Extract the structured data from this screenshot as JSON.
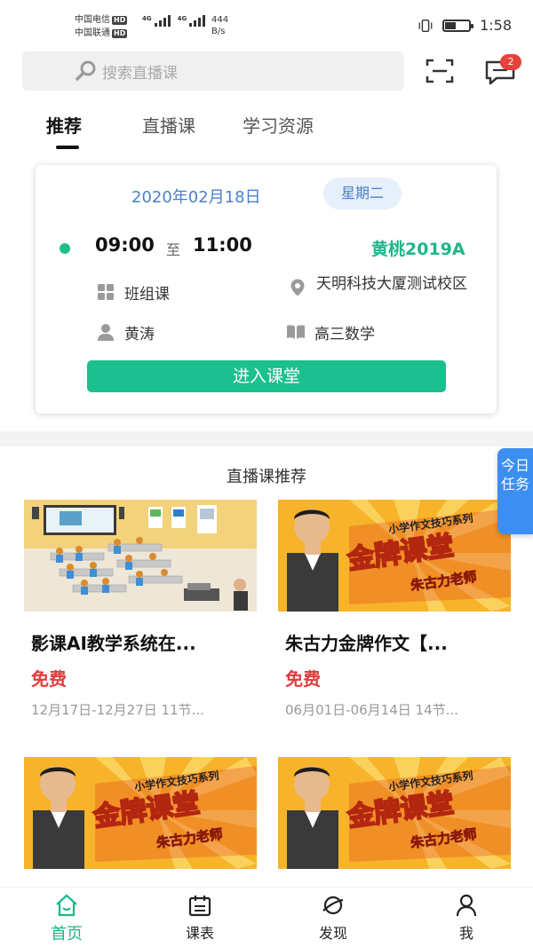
{
  "status_bar": {
    "carrier1": "中国电信",
    "carrier2": "中国联通",
    "hd": "HD",
    "net_label": "4G",
    "speed_value": "444",
    "speed_unit": "B/s",
    "time": "1:58"
  },
  "header": {
    "search_placeholder": "搜索直播课",
    "message_badge": "2",
    "tabs": [
      {
        "label": "推荐"
      },
      {
        "label": "直播课"
      },
      {
        "label": "学习资源"
      }
    ]
  },
  "schedule_card": {
    "date": "2020年02月18日",
    "weekday": "星期二",
    "start_time": "09:00",
    "to_label": "至",
    "end_time": "11:00",
    "class_name": "黄桃2019A",
    "course_type": "班组课",
    "location": "天明科技大厦测试校区",
    "teacher": "黄涛",
    "subject": "高三数学",
    "enter_button": "进入课堂"
  },
  "recommend": {
    "title": "直播课推荐",
    "courses": [
      {
        "title": "影课AI教学系统在...",
        "price": "免费",
        "dates": "12月17日-12月27日",
        "lessons": "11节..."
      },
      {
        "title": "朱古力金牌作文【...",
        "price": "免费",
        "dates": "06月01日-06月14日",
        "lessons": "14节..."
      },
      {
        "title": "",
        "price": "",
        "dates": "",
        "lessons": ""
      },
      {
        "title": "",
        "price": "",
        "dates": "",
        "lessons": ""
      }
    ],
    "banner_text": {
      "series": "小学作文技巧系列",
      "main": "金牌课堂",
      "teacher": "朱古力老师"
    }
  },
  "side_task": "今日任务",
  "bottom_nav": [
    {
      "label": "首页",
      "icon": "home-icon",
      "active": true
    },
    {
      "label": "课表",
      "icon": "calendar-icon"
    },
    {
      "label": "发现",
      "icon": "discover-icon"
    },
    {
      "label": "我",
      "icon": "person-icon"
    }
  ],
  "colors": {
    "accent": "#1fb58a",
    "button": "#1cc08e",
    "price": "#e23c3c",
    "date": "#4a7fc9",
    "side_task": "#3c8ef0"
  }
}
